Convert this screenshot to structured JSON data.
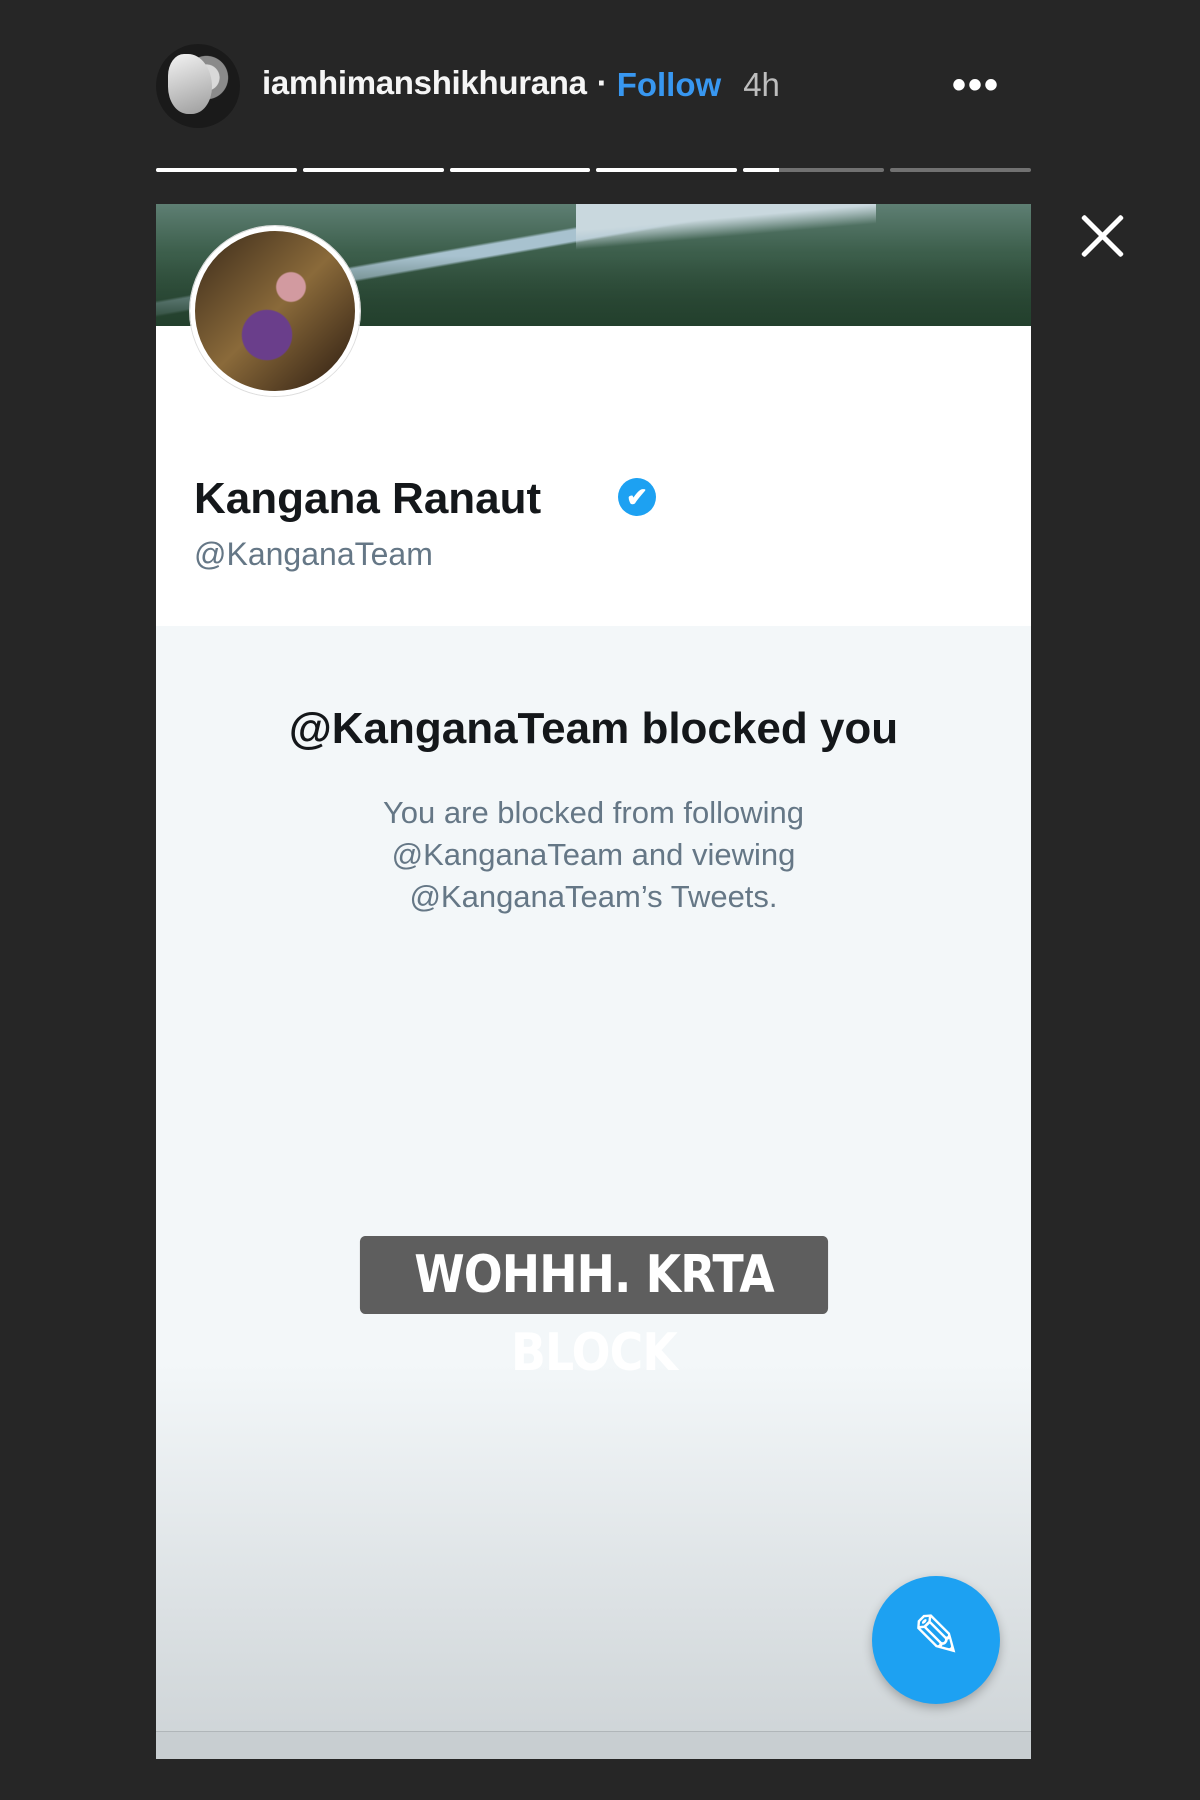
{
  "header": {
    "username": "iamhimanshikhurana",
    "separator": "·",
    "follow_label": "Follow",
    "time": "4h",
    "more_label": "•••"
  },
  "progress": {
    "segments": [
      1,
      1,
      1,
      1,
      0.25,
      0
    ]
  },
  "screenshot": {
    "profile": {
      "name": "Kangana Ranaut",
      "verified_icon": "✔",
      "handle": "@KanganaTeam"
    },
    "blocked": {
      "title": "@KanganaTeam blocked you",
      "subtitle": "You are blocked from following @KanganaTeam and viewing @KanganaTeam’s Tweets."
    },
    "sticker_text": "WOHHH. KRTA BLOCK",
    "fab_icon": "compose-tweet-icon",
    "fab_glyph": "✎"
  },
  "colors": {
    "follow": "#3897f0",
    "twitter_blue": "#1da1f2",
    "background": "#262626"
  }
}
